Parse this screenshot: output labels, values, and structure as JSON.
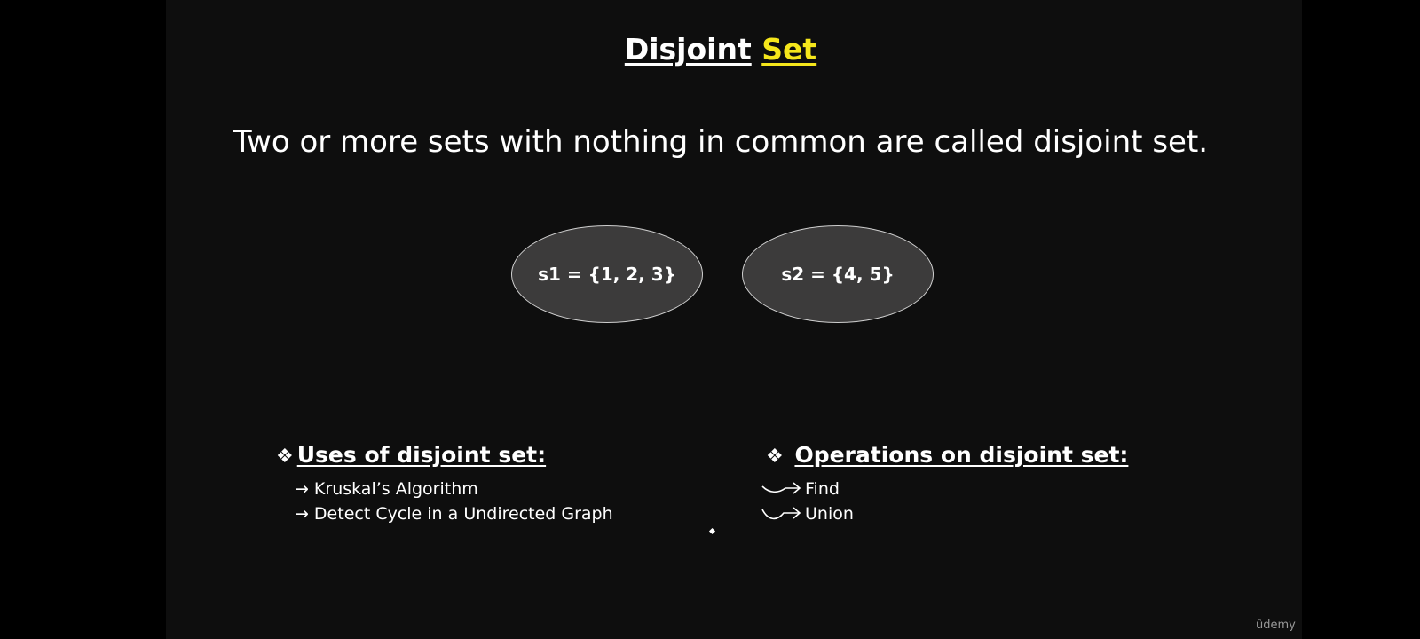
{
  "slide": {
    "title_part1": "Disjoint",
    "title_part2": "Set",
    "definition": "Two or more sets with nothing in common are called disjoint set.",
    "sets": [
      {
        "label": "s1 = {1, 2, 3}"
      },
      {
        "label": "s2 = {4, 5}"
      }
    ],
    "uses": {
      "bullet": "❖",
      "heading": "Uses of disjoint set:",
      "items": [
        {
          "arrow": "→",
          "text": "Kruskal’s Algorithm"
        },
        {
          "arrow": "→",
          "text": "Detect Cycle in a Undirected Graph"
        }
      ]
    },
    "operations": {
      "bullet": "❖",
      "heading": "Operations on disjoint set:",
      "items": [
        {
          "icon": "curved-arrow-icon",
          "text": "Find"
        },
        {
          "icon": "curved-arrow-icon",
          "text": "Union"
        }
      ]
    },
    "colors": {
      "background": "#0e0e0e",
      "accent": "#f5e61b",
      "ellipse_fill": "#3c3b3b"
    }
  },
  "watermark": "ûdemy"
}
